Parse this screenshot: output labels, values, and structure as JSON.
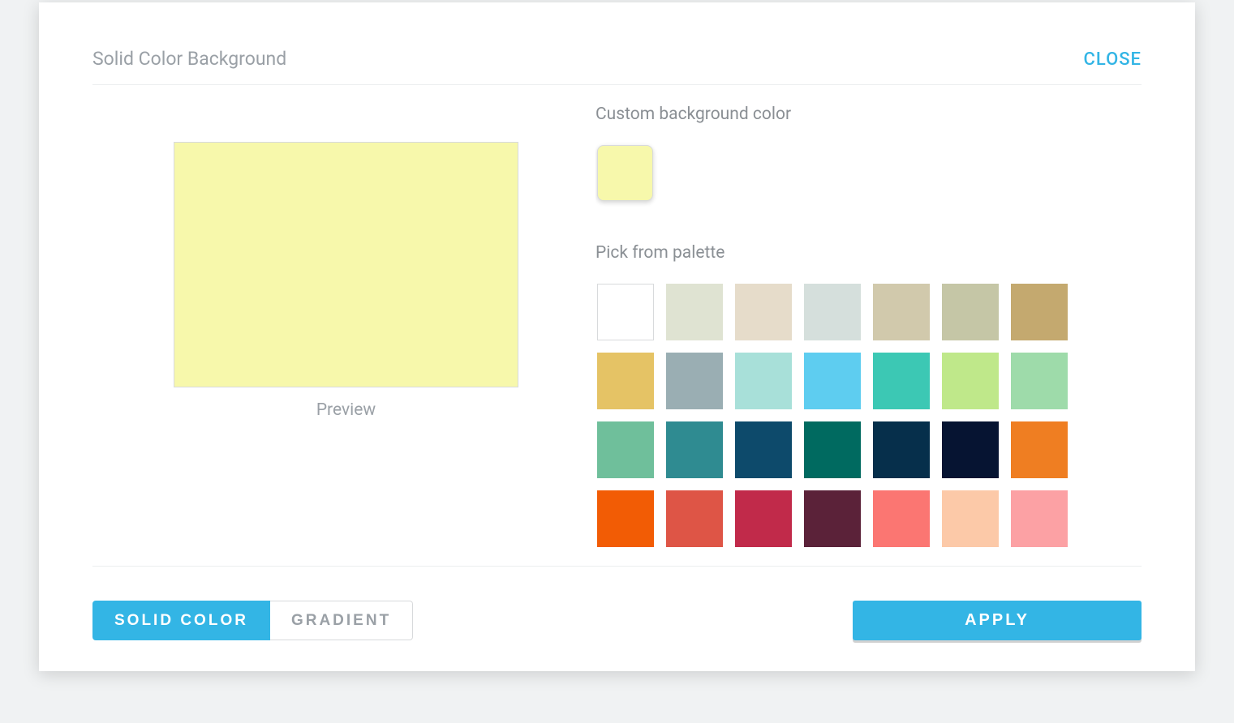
{
  "modal": {
    "title": "Solid Color Background",
    "close_label": "CLOSE"
  },
  "preview": {
    "label": "Preview",
    "color": "#f7f8ab"
  },
  "custom": {
    "label": "Custom background color",
    "color": "#f7f8ab"
  },
  "palette": {
    "label": "Pick from palette",
    "colors": [
      "#ffffff",
      "#dfe3d2",
      "#e6dcca",
      "#d5dfdc",
      "#d1c9ac",
      "#c5c6a6",
      "#c4a96f",
      "#e5c365",
      "#9aaeb3",
      "#a8e0d9",
      "#5ecdf0",
      "#3cc8b4",
      "#bfe88a",
      "#9edbaa",
      "#6fbf9b",
      "#2f8b91",
      "#0d4a6b",
      "#006a60",
      "#062f4b",
      "#061432",
      "#ef7e22",
      "#f25c05",
      "#de5546",
      "#c12a4a",
      "#5b2239",
      "#fb7672",
      "#fcc9a8",
      "#fca1a4"
    ]
  },
  "footer": {
    "tabs": {
      "solid": "SOLID COLOR",
      "gradient": "GRADIENT",
      "active": "solid"
    },
    "apply_label": "APPLY"
  }
}
